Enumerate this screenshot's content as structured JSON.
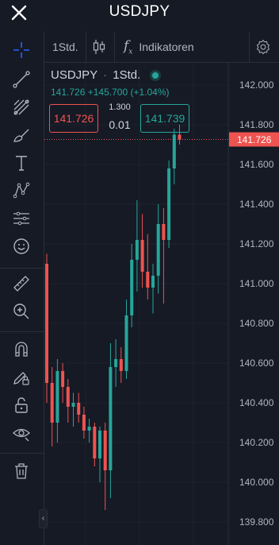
{
  "topbar": {
    "title": "USDJPY",
    "close_icon": "close-icon"
  },
  "toolbar": {
    "interval": "1Std.",
    "chart_type_icon": "candlestick-icon",
    "indicators_label": "Indikatoren",
    "indicators_icon": "fx-icon",
    "settings_icon": "gear-icon"
  },
  "drawing_tools": [
    "crosshair-icon",
    "trend-line-icon",
    "fib-tool-icon",
    "brush-icon",
    "text-icon",
    "pattern-icon",
    "measure-lines-icon",
    "emoji-icon",
    "ruler-icon",
    "zoom-in-icon",
    "magnet-icon",
    "lock-drawing-icon",
    "lock-icon",
    "eye-icon",
    "trash-icon"
  ],
  "legend": {
    "symbol": "USDJPY",
    "separator": "·",
    "interval": "1Std.",
    "last": "141.726",
    "change": "+145.700",
    "change_pct": "(+1.04%)"
  },
  "trade": {
    "sell_price": "141.726",
    "buy_price": "141.739",
    "lot_size": "1.300",
    "spread": "0.01"
  },
  "price_scale": {
    "labels": [
      "142.000",
      "141.800",
      "141.600",
      "141.400",
      "141.200",
      "141.000",
      "140.800",
      "140.600",
      "140.400",
      "140.200",
      "140.000",
      "139.800"
    ],
    "current_label": "141.726"
  },
  "colors": {
    "up": "#26a69a",
    "down": "#ef5350",
    "background": "#161a25",
    "grid": "#1f2330",
    "accent": "#2962ff"
  },
  "chart_data": {
    "type": "candlestick",
    "symbol": "USDJPY",
    "interval": "1Std.",
    "ylim": [
      139.75,
      142.15
    ],
    "last_price": 141.726,
    "candles": [
      {
        "o": 141.1,
        "h": 141.15,
        "l": 140.4,
        "c": 140.5
      },
      {
        "o": 140.5,
        "h": 140.58,
        "l": 140.18,
        "c": 140.3
      },
      {
        "o": 140.3,
        "h": 140.62,
        "l": 140.2,
        "c": 140.56
      },
      {
        "o": 140.56,
        "h": 140.6,
        "l": 140.4,
        "c": 140.48
      },
      {
        "o": 140.48,
        "h": 140.52,
        "l": 140.3,
        "c": 140.38
      },
      {
        "o": 140.38,
        "h": 140.45,
        "l": 140.28,
        "c": 140.4
      },
      {
        "o": 140.4,
        "h": 140.45,
        "l": 140.3,
        "c": 140.34
      },
      {
        "o": 140.34,
        "h": 140.38,
        "l": 140.22,
        "c": 140.26
      },
      {
        "o": 140.26,
        "h": 140.32,
        "l": 140.2,
        "c": 140.28
      },
      {
        "o": 140.28,
        "h": 140.3,
        "l": 140.08,
        "c": 140.12
      },
      {
        "o": 140.12,
        "h": 140.28,
        "l": 140.0,
        "c": 140.26
      },
      {
        "o": 140.26,
        "h": 140.3,
        "l": 139.86,
        "c": 140.06
      },
      {
        "o": 140.06,
        "h": 140.7,
        "l": 139.92,
        "c": 140.58
      },
      {
        "o": 140.58,
        "h": 140.72,
        "l": 140.48,
        "c": 140.62
      },
      {
        "o": 140.62,
        "h": 140.68,
        "l": 140.5,
        "c": 140.56
      },
      {
        "o": 140.56,
        "h": 140.92,
        "l": 140.52,
        "c": 140.84
      },
      {
        "o": 140.84,
        "h": 141.2,
        "l": 140.78,
        "c": 141.12
      },
      {
        "o": 141.12,
        "h": 141.42,
        "l": 140.96,
        "c": 141.22
      },
      {
        "o": 141.22,
        "h": 141.35,
        "l": 140.98,
        "c": 141.06
      },
      {
        "o": 141.06,
        "h": 141.25,
        "l": 140.92,
        "c": 140.98
      },
      {
        "o": 140.98,
        "h": 141.1,
        "l": 140.85,
        "c": 141.04
      },
      {
        "o": 141.04,
        "h": 141.4,
        "l": 140.95,
        "c": 141.3
      },
      {
        "o": 141.3,
        "h": 141.38,
        "l": 140.9,
        "c": 141.22
      },
      {
        "o": 141.22,
        "h": 141.62,
        "l": 141.18,
        "c": 141.58
      },
      {
        "o": 141.58,
        "h": 141.78,
        "l": 141.5,
        "c": 141.75
      },
      {
        "o": 141.75,
        "h": 141.8,
        "l": 141.7,
        "c": 141.726
      }
    ]
  }
}
